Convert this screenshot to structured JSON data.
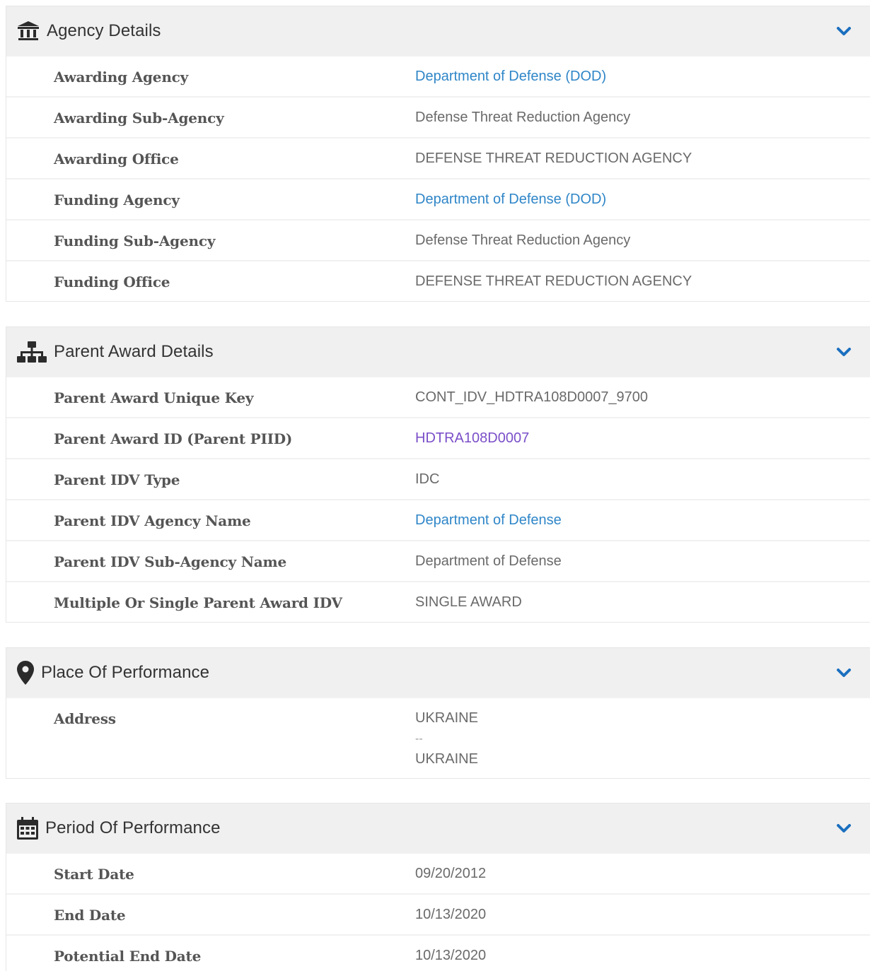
{
  "sections": {
    "agency": {
      "title": "Agency Details",
      "icon": "landmark-icon",
      "rows": [
        {
          "label": "Awarding Agency",
          "value": "Department of Defense (DOD)"
        },
        {
          "label": "Awarding Sub-Agency",
          "value": "Defense Threat Reduction Agency"
        },
        {
          "label": "Awarding Office",
          "value": "DEFENSE THREAT REDUCTION AGENCY"
        },
        {
          "label": "Funding Agency",
          "value": "Department of Defense (DOD)"
        },
        {
          "label": "Funding Sub-Agency",
          "value": "Defense Threat Reduction Agency"
        },
        {
          "label": "Funding Office",
          "value": "DEFENSE THREAT REDUCTION AGENCY"
        }
      ]
    },
    "parent": {
      "title": "Parent Award Details",
      "icon": "sitemap-icon",
      "rows": [
        {
          "label": "Parent Award Unique Key",
          "value": "CONT_IDV_HDTRA108D0007_9700"
        },
        {
          "label": "Parent Award ID (Parent PIID)",
          "value": "HDTRA108D0007"
        },
        {
          "label": "Parent IDV Type",
          "value": "IDC"
        },
        {
          "label": "Parent IDV Agency Name",
          "value": "Department of Defense"
        },
        {
          "label": "Parent IDV Sub-Agency Name",
          "value": "Department of Defense"
        },
        {
          "label": "Multiple Or Single Parent Award IDV",
          "value": "SINGLE AWARD"
        }
      ]
    },
    "place": {
      "title": "Place Of Performance",
      "icon": "map-pin-icon",
      "rows": [
        {
          "label": "Address",
          "lines": [
            "UKRAINE",
            "--",
            "UKRAINE"
          ]
        }
      ]
    },
    "period": {
      "title": "Period Of Performance",
      "icon": "calendar-icon",
      "rows": [
        {
          "label": "Start Date",
          "value": "09/20/2012"
        },
        {
          "label": "End Date",
          "value": "10/13/2020"
        },
        {
          "label": "Potential End Date",
          "value": "10/13/2020"
        }
      ]
    }
  },
  "colors": {
    "link": "#2f86c8",
    "visited_link": "#7b4fc9",
    "chevron": "#1b6fbf",
    "header_bg": "#f0f0f0"
  }
}
